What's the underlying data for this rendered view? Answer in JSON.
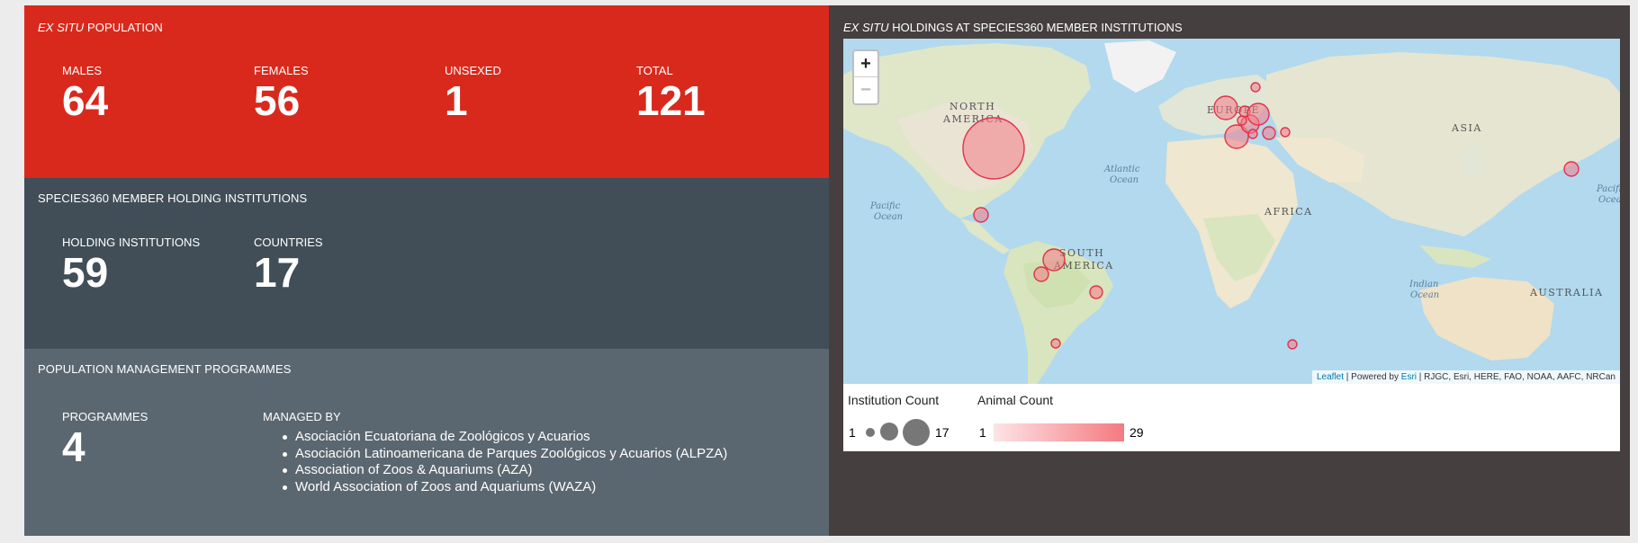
{
  "population": {
    "title_em": "EX SITU",
    "title_rest": " POPULATION",
    "stats": [
      {
        "label": "MALES",
        "value": "64"
      },
      {
        "label": "FEMALES",
        "value": "56"
      },
      {
        "label": "UNSEXED",
        "value": "1"
      },
      {
        "label": "TOTAL",
        "value": "121"
      }
    ]
  },
  "institutions": {
    "title": "SPECIES360 MEMBER HOLDING INSTITUTIONS",
    "stats": [
      {
        "label": "HOLDING INSTITUTIONS",
        "value": "59"
      },
      {
        "label": "COUNTRIES",
        "value": "17"
      }
    ]
  },
  "programmes": {
    "title": "POPULATION MANAGEMENT PROGRAMMES",
    "count_label": "PROGRAMMES",
    "count_value": "4",
    "managed_by_label": "MANAGED BY",
    "managed_by": [
      "Asociación Ecuatoriana de Zoológicos y Acuarios",
      "Asociación Latinoamericana de Parques Zoológicos y Acuarios (ALPZA)",
      "Association of Zoos & Aquariums (AZA)",
      "World Association of Zoos and Aquariums (WAZA)"
    ]
  },
  "map": {
    "title_em": "EX SITU",
    "title_rest": " HOLDINGS AT SPECIES360 MEMBER INSTITUTIONS",
    "zoom_in": "+",
    "zoom_out": "−",
    "attribution_leaflet": "Leaflet",
    "attribution_sep": " | Powered by ",
    "attribution_esri": "Esri",
    "attribution_rest": " | RJGC, Esri, HERE, FAO, NOAA, AAFC, NRCan",
    "labels": {
      "north_america_1": "NORTH",
      "north_america_2": "AMERICA",
      "south_america_1": "SOUTH",
      "south_america_2": "AMERICA",
      "europe": "EUROPE",
      "asia": "ASIA",
      "africa": "AFRICA",
      "australia": "AUSTRALIA",
      "atlantic_1": "Atlantic",
      "atlantic_2": "Ocean",
      "pacific_1": "Pacific",
      "pacific_2": "Ocean",
      "pacific_right_1": "Pacifi",
      "pacific_right_2": "Ocea",
      "indian_1": "Indian",
      "indian_2": "Ocean"
    },
    "legend": {
      "institution_title": "Institution Count",
      "institution_min": "1",
      "institution_max": "17",
      "animal_title": "Animal Count",
      "animal_min": "1",
      "animal_max": "29",
      "gradient_from": "#fde4e6",
      "gradient_to": "#f47a80"
    }
  },
  "colors": {
    "red": "#d9291c",
    "dark": "#414e58",
    "mid": "#5b6770",
    "map_panel": "#463f3f",
    "bubble_stroke": "#e0334c"
  }
}
